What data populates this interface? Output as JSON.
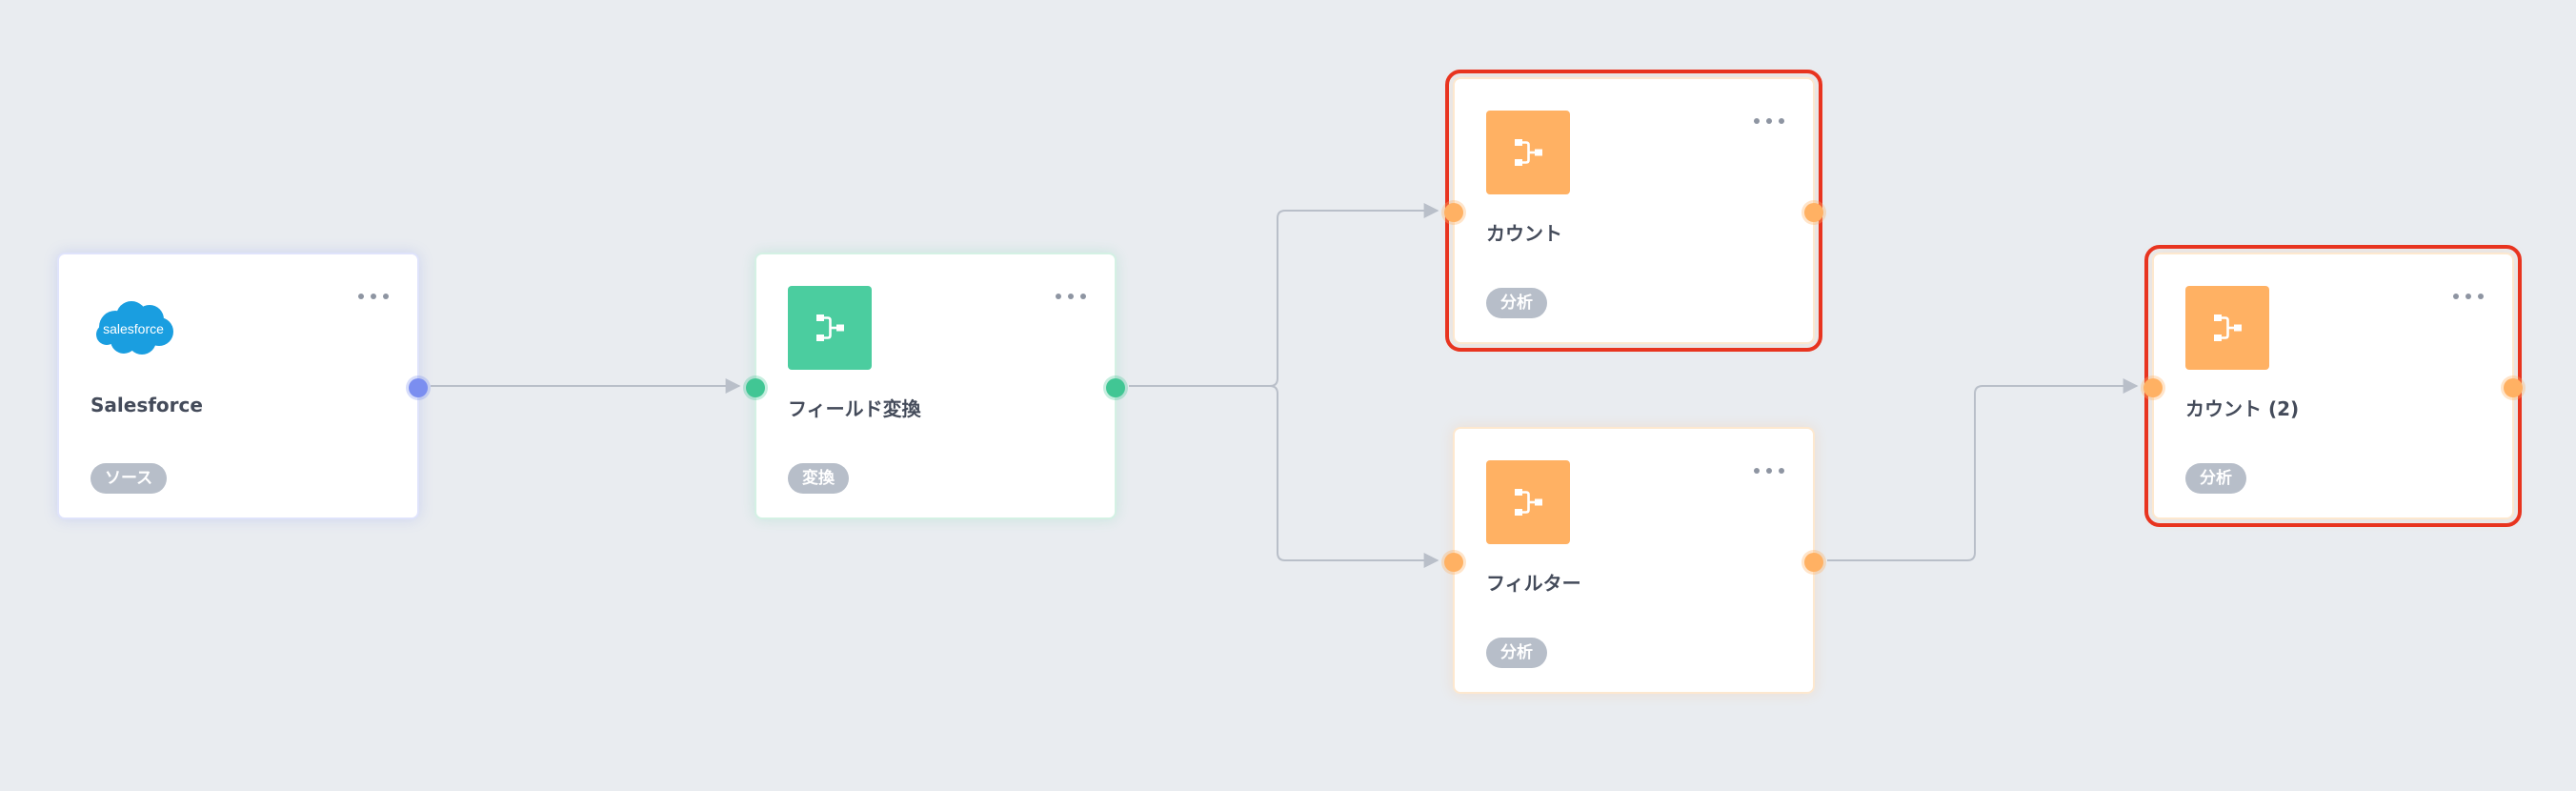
{
  "colors": {
    "background": "#e9ecf0",
    "edge": "#b9bfc9",
    "selection": "#e8341f",
    "source_port": "#7b8ef0",
    "transform": "#4bcd9f",
    "analysis": "#ffb163",
    "tag_bg": "#b7bec9"
  },
  "nodes": {
    "salesforce": {
      "title": "Salesforce",
      "tag": "ソース",
      "logo_text": "salesforce",
      "icon": "salesforce-logo",
      "selected": false
    },
    "field_transform": {
      "title": "フィールド変換",
      "tag": "変換",
      "icon": "flow-icon",
      "selected": false
    },
    "count": {
      "title": "カウント",
      "tag": "分析",
      "icon": "flow-icon",
      "selected": true
    },
    "filter": {
      "title": "フィルター",
      "tag": "分析",
      "icon": "flow-icon",
      "selected": false
    },
    "count2": {
      "title": "カウント (2)",
      "tag": "分析",
      "icon": "flow-icon",
      "selected": true
    }
  },
  "edges": [
    {
      "from": "salesforce",
      "to": "field_transform"
    },
    {
      "from": "field_transform",
      "to": "count"
    },
    {
      "from": "field_transform",
      "to": "filter"
    },
    {
      "from": "filter",
      "to": "count2"
    }
  ]
}
